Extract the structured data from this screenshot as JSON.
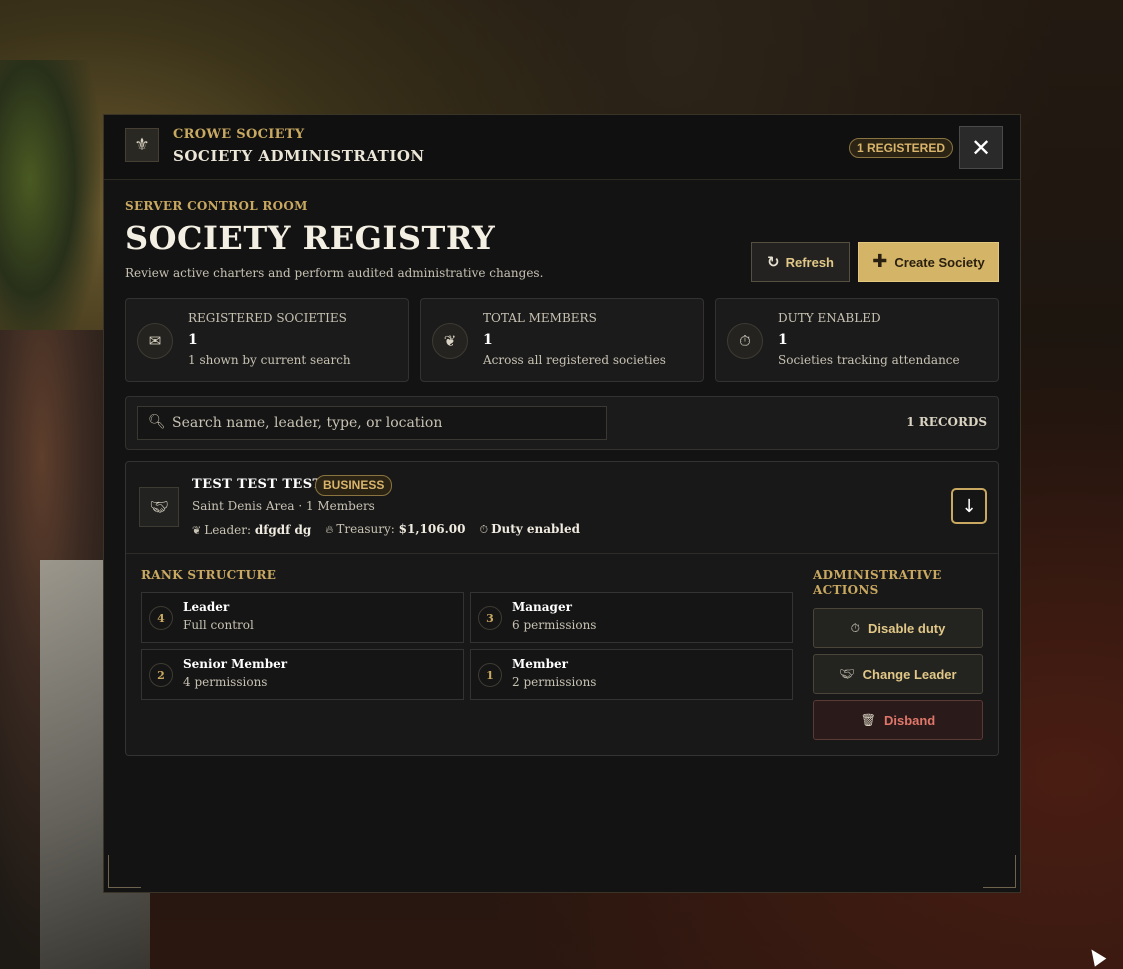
{
  "header": {
    "overline": "CROWE SOCIETY",
    "title": "SOCIETY ADMINISTRATION",
    "registered_badge": "1 REGISTERED",
    "close_glyph": "✕",
    "icon": "seal-icon"
  },
  "page": {
    "overline": "SERVER CONTROL ROOM",
    "title": "SOCIETY REGISTRY",
    "subtitle": "Review active charters and perform audited administrative changes.",
    "refresh_label": "Refresh",
    "create_label": "Create Society"
  },
  "stats": [
    {
      "label": "REGISTERED SOCIETIES",
      "value": "1",
      "note": "1 shown by current search",
      "icon": "scroll-icon"
    },
    {
      "label": "TOTAL MEMBERS",
      "value": "1",
      "note": "Across all registered societies",
      "icon": "members-icon"
    },
    {
      "label": "DUTY ENABLED",
      "value": "1",
      "note": "Societies tracking attendance",
      "icon": "stopwatch-icon"
    }
  ],
  "search": {
    "placeholder": "Search name, leader, type, or location",
    "value": "",
    "records_label": "1 RECORDS"
  },
  "society": {
    "name": "TEST TEST TEST",
    "type": "BUSINESS",
    "meta": "Saint Denis Area · 1 Members",
    "leader_label": "Leader:",
    "leader_value": "dfgdf dg",
    "treasury_label": "Treasury:",
    "treasury_value": "$1,106.00",
    "duty_label": "Duty enabled",
    "rank_section": "RANK STRUCTURE",
    "ranks": [
      {
        "num": "4",
        "name": "Leader",
        "perm": "Full control"
      },
      {
        "num": "3",
        "name": "Manager",
        "perm": "6 permissions"
      },
      {
        "num": "2",
        "name": "Senior Member",
        "perm": "4 permissions"
      },
      {
        "num": "1",
        "name": "Member",
        "perm": "2 permissions"
      }
    ],
    "actions_section": "ADMINISTRATIVE ACTIONS",
    "actions": [
      {
        "label": "Disable duty",
        "icon": "stopwatch-icon"
      },
      {
        "label": "Change Leader",
        "icon": "handshake-icon"
      },
      {
        "label": "Disband",
        "icon": "trash-icon"
      }
    ]
  },
  "colors": {
    "accent_gold": "#c9a861",
    "primary_button": "#d4b466",
    "danger_text": "#e0776a",
    "panel_bg": "#131313"
  }
}
